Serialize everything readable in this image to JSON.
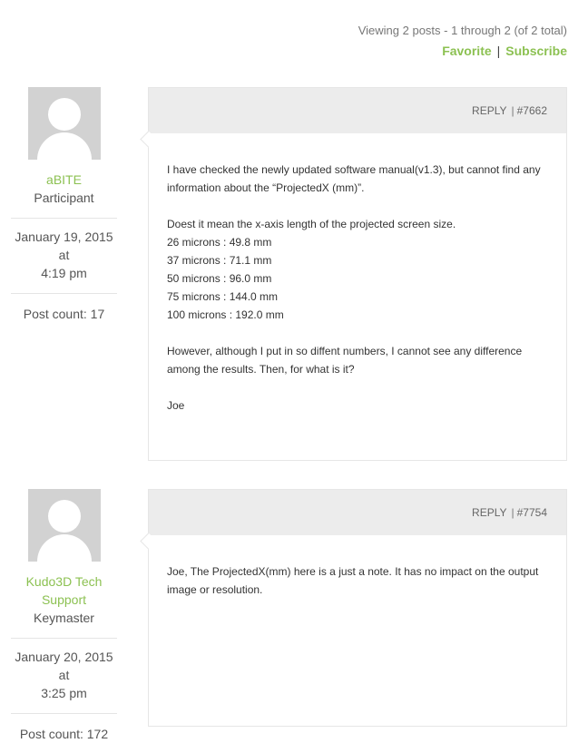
{
  "header": {
    "viewing_text": "Viewing 2 posts - 1 through 2 (of 2 total)",
    "favorite_label": "Favorite",
    "separator": "|",
    "subscribe_label": "Subscribe"
  },
  "posts": [
    {
      "author_name": "aBITE",
      "author_role": "Participant",
      "date_line1": "January 19, 2015 at",
      "date_line2": "4:19 pm",
      "post_count": "Post count: 17",
      "reply_label": "REPLY",
      "separator": "|",
      "post_id": "#7662",
      "paragraphs": [
        [
          "I have checked the newly updated software manual(v1.3), but cannot find any",
          "information about the “ProjectedX (mm)”."
        ],
        [
          "Doest it mean the x-axis length of the projected screen size.",
          "26 microns : 49.8 mm",
          "37 microns : 71.1 mm",
          "50 microns : 96.0 mm",
          "75 microns : 144.0 mm",
          "100 microns : 192.0 mm"
        ],
        [
          "However, although I put in so diffent numbers, I cannot see any difference",
          "among the results. Then, for what is it?"
        ],
        [
          "Joe"
        ]
      ]
    },
    {
      "author_name_line1": "Kudo3D Tech",
      "author_name_line2": "Support",
      "author_role": "Keymaster",
      "date_line1": "January 20, 2015 at",
      "date_line2": "3:25 pm",
      "post_count": "Post count: 172",
      "reply_label": "REPLY",
      "separator": "|",
      "post_id": "#7754",
      "paragraphs": [
        [
          "Joe, The ProjectedX(mm) here is a just a note. It has no impact on the output",
          "image or resolution."
        ]
      ]
    }
  ],
  "colors": {
    "accent": "#8cc152",
    "header_bg": "#ececec",
    "avatar_bg": "#d2d2d2"
  }
}
